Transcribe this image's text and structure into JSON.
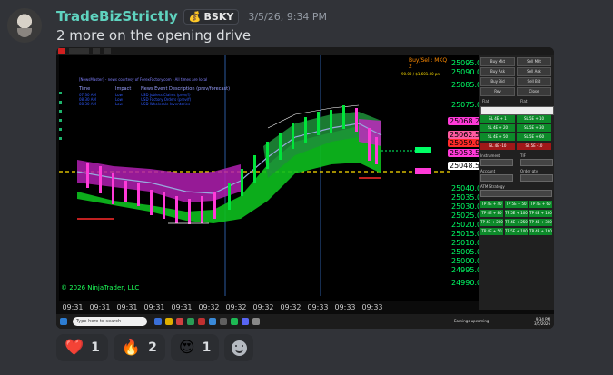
{
  "author": {
    "username": "TradeBizStrictly",
    "tag_icon": "money-bag-icon",
    "tag_label": "BSKY",
    "timestamp": "3/5/26, 9:34 PM"
  },
  "message": {
    "text": "2 more on the opening drive"
  },
  "screenshot": {
    "chart_title": "Buy/Sell: MKQ 2",
    "pnl_text": "90.00 / $1,601.00 pnl",
    "copyright": "© 2026 NinjaTrader, LLC",
    "price_labels": [
      "25095.00",
      "25090.00",
      "25085.00",
      "25075.00",
      "25040.00",
      "25035.00",
      "25030.00",
      "25025.00",
      "25020.00",
      "25015.00",
      "25010.00",
      "25005.00",
      "25000.00",
      "24995.00",
      "24990.00"
    ],
    "price_tags": [
      {
        "text": "25068.25",
        "color": "#ff3ad8"
      },
      {
        "text": "25062.50",
        "color": "#ff5aa0"
      },
      {
        "text": "25059.00",
        "color": "#ff2a2a"
      },
      {
        "text": "25053.50",
        "color": "#ff3ad8"
      },
      {
        "text": "25048.50",
        "color": "#ffffff"
      }
    ],
    "time_labels": [
      "09:31",
      "09:31",
      "09:31",
      "09:31",
      "09:31",
      "09:32",
      "09:32",
      "09:32",
      "09:32",
      "09:33",
      "09:33",
      "09:33"
    ],
    "news": {
      "title": "[NewsMaster] - news courtesy of ForexFactory.com - All times are local",
      "headers": [
        "Time",
        "Impact",
        "News Event Description (prev/forecast)"
      ],
      "rows": [
        [
          "07:30 AM",
          "Low",
          "USD Jobless Claims (prev/f)"
        ],
        [
          "08:30 AM",
          "Low",
          "USD Factory Orders (prev/f)"
        ],
        [
          "08:30 AM",
          "Low",
          "USD Wholesale Inventories"
        ]
      ]
    },
    "order_panel": {
      "buttons": [
        [
          "Buy Mkt",
          "Sell Mkt"
        ],
        [
          "Buy Ask",
          "Sell Ask"
        ],
        [
          "Buy Bid",
          "Sell Bid"
        ],
        [
          "Rev",
          "Close"
        ]
      ],
      "flat_label": "Flat",
      "pos_label": "Flat",
      "green_rows": [
        [
          "SL 4E + 1",
          "SL 5E + 10"
        ],
        [
          "SL 4E + 20",
          "SL 5E + 30"
        ],
        [
          "SL 4E + 50",
          "SL 5E + 60"
        ]
      ],
      "red_row": [
        "SL 4E -10",
        "SL 5E -10"
      ],
      "labels": [
        "Instrument",
        "TIF",
        "Account",
        "Order qty",
        "ATM Strategy"
      ],
      "tp_rows": [
        [
          "TP 4E + 40",
          "TP 5E + 50",
          "TP 4E + 60"
        ],
        [
          "TP 4E + 80",
          "TP 5E + 100",
          "TP 4E + 160"
        ],
        [
          "TP 4E + 200",
          "TP 4E + 250",
          "TP 4E + 300"
        ],
        [
          "TP 4E + 50",
          "TP 5E + 100",
          "TP 4E + 160"
        ]
      ]
    },
    "taskbar": {
      "search_placeholder": "Type here to search",
      "weather": "Earnings upcoming",
      "clock_time": "9:34 PM",
      "clock_date": "3/5/2026"
    }
  },
  "reactions": [
    {
      "icon": "heart-emoji",
      "glyph": "❤️",
      "count": "1"
    },
    {
      "icon": "fire-emoji",
      "glyph": "🔥",
      "count": "2"
    },
    {
      "icon": "heart-eyes-emoji",
      "glyph": "😍",
      "count": "1"
    }
  ]
}
